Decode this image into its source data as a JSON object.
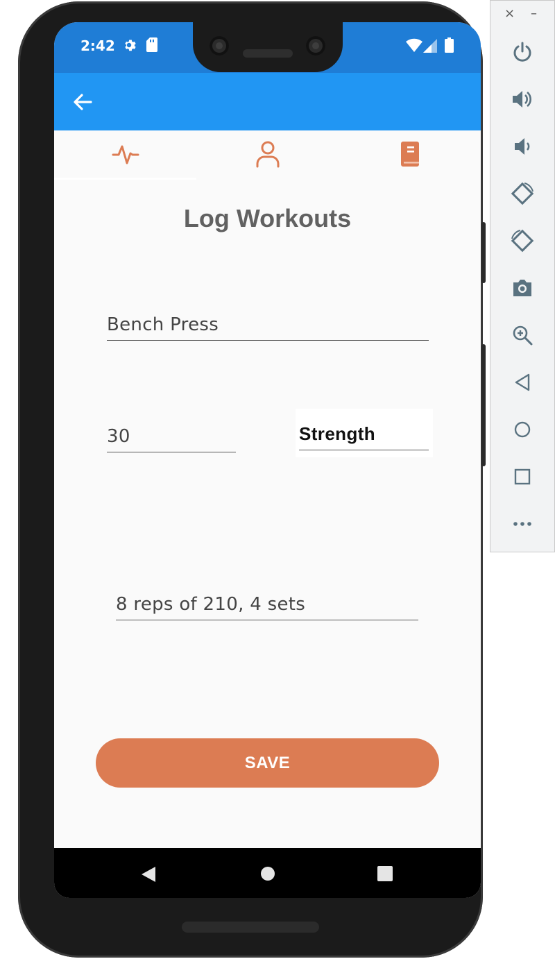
{
  "status_bar": {
    "time": "2:42",
    "icons": [
      "gear-icon",
      "sd-card-icon",
      "wifi-icon",
      "signal-icon",
      "battery-icon"
    ]
  },
  "app_bar": {
    "back_icon": "arrow-left-icon",
    "color": "#2196f3"
  },
  "tabs": [
    {
      "icon": "activity-icon",
      "selected": true
    },
    {
      "icon": "person-icon",
      "selected": false
    },
    {
      "icon": "book-icon",
      "selected": false
    }
  ],
  "page": {
    "title": "Log Workouts"
  },
  "form": {
    "exercise_name": "Bench Press",
    "duration": "30",
    "category": "Strength",
    "details": "8 reps of 210, 4 sets",
    "save_label": "SAVE"
  },
  "colors": {
    "accent": "#dc7c53",
    "primary": "#2196f3",
    "status_bar": "#1f7dd6"
  },
  "nav_bar": {
    "buttons": [
      "back-triangle-icon",
      "home-circle-icon",
      "recents-square-icon"
    ]
  },
  "emulator_panel": {
    "window_controls": {
      "close": "×",
      "minimize": "–"
    },
    "buttons": [
      "power-icon",
      "volume-up-icon",
      "volume-down-icon",
      "rotate-left-icon",
      "rotate-right-icon",
      "camera-icon",
      "zoom-icon",
      "back-icon",
      "home-icon",
      "overview-icon",
      "more-icon"
    ]
  }
}
